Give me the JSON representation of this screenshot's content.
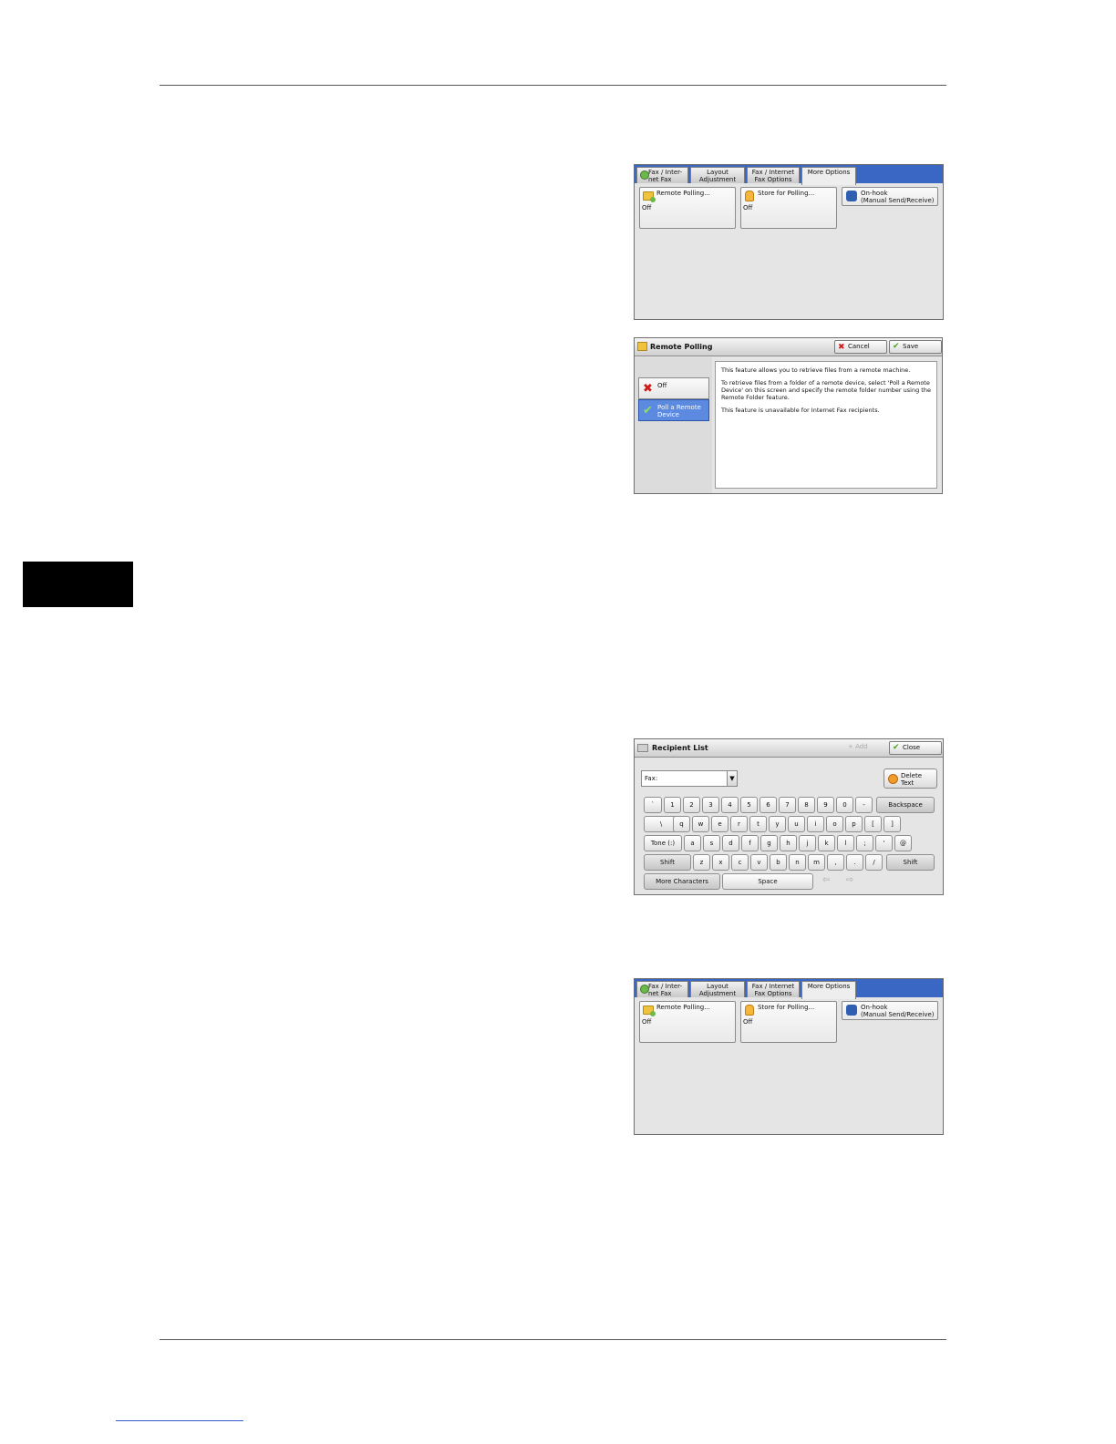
{
  "more_options": {
    "tabs": [
      "Fax / Inter-\nnet Fax",
      "Layout\nAdjustment",
      "Fax / Internet\nFax Options",
      "More Options"
    ],
    "remote_polling": {
      "label": "Remote Polling...",
      "value": "Off"
    },
    "store_for_polling": {
      "label": "Store for Polling...",
      "value": "Off"
    },
    "on_hook": {
      "label": "On-hook\n(Manual Send/Receive)"
    }
  },
  "remote_polling_dialog": {
    "title": "Remote Polling",
    "cancel": "Cancel",
    "save": "Save",
    "off": "Off",
    "poll": "Poll a Remote\nDevice",
    "info": [
      "This feature allows you to retrieve files from a remote machine.",
      "To retrieve files from a folder of a remote device, select 'Poll a Remote Device' on this screen and specify the remote folder number using the Remote Folder feature.",
      "This feature is unavailable for Internet Fax recipients."
    ]
  },
  "recipient_dialog": {
    "title": "Recipient List",
    "add": "+ Add",
    "close": "Close",
    "dropdown": "Fax:",
    "delete_text": "Delete Text",
    "row1": [
      "`",
      "1",
      "2",
      "3",
      "4",
      "5",
      "6",
      "7",
      "8",
      "9",
      "0",
      "-"
    ],
    "backspace": "Backspace",
    "row2": [
      "\\",
      "q",
      "w",
      "e",
      "r",
      "t",
      "y",
      "u",
      "i",
      "o",
      "p",
      "[",
      "]"
    ],
    "tone": "Tone (:)",
    "row3": [
      "a",
      "s",
      "d",
      "f",
      "g",
      "h",
      "j",
      "k",
      "l",
      ";",
      "'",
      "@"
    ],
    "shift": "Shift",
    "row4": [
      "z",
      "x",
      "c",
      "v",
      "b",
      "n",
      "m",
      ",",
      ".",
      "/"
    ],
    "more_characters": "More Characters",
    "space": "Space",
    "arrow_left": "⇦",
    "arrow_right": "⇨"
  }
}
